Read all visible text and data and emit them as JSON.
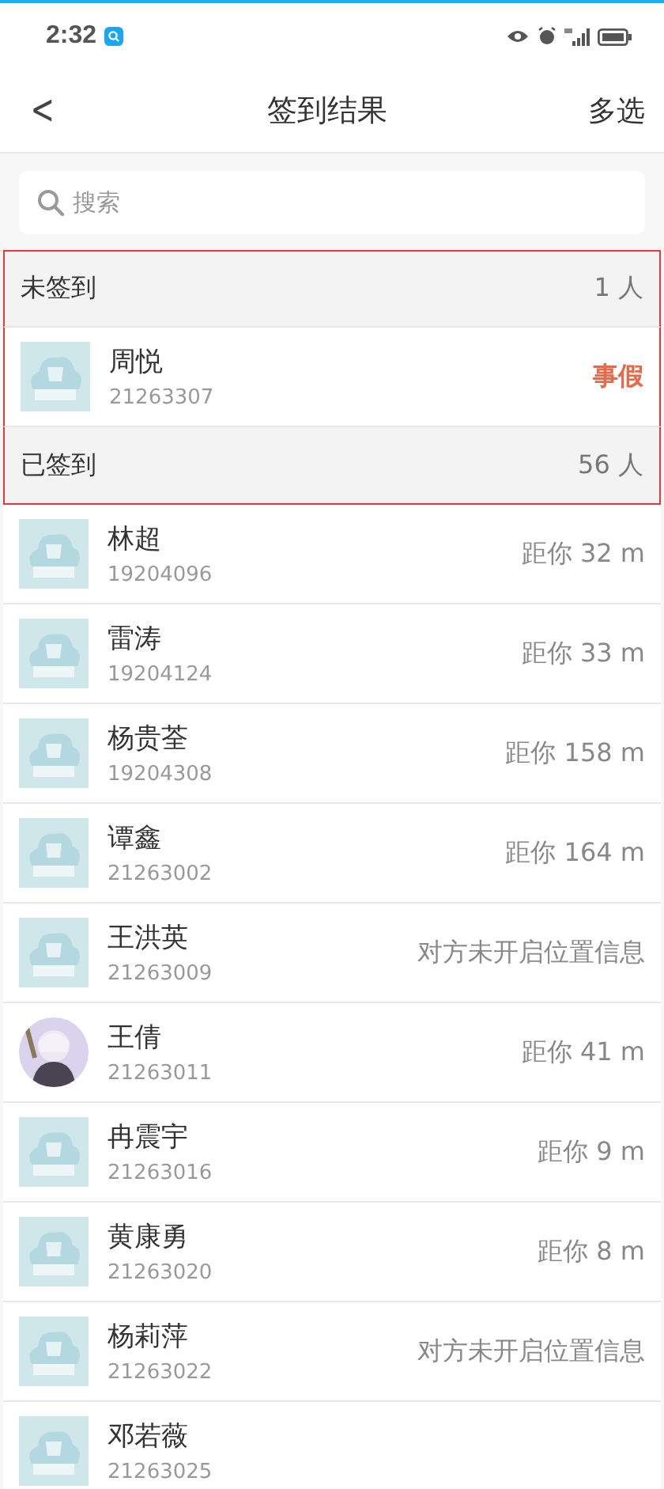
{
  "status_bar": {
    "time": "2:32"
  },
  "header": {
    "back": "<",
    "title": "签到结果",
    "action": "多选"
  },
  "search": {
    "placeholder": "搜索"
  },
  "items": [
    {
      "kind": "header",
      "title": "未签到",
      "count": "1 人",
      "highlighted": true
    },
    {
      "kind": "person",
      "name": "周悦",
      "id": "21263307",
      "status": {
        "text": "事假",
        "kind": "leave"
      },
      "avatar": {
        "kind": "placeholder"
      },
      "highlighted": true
    },
    {
      "kind": "header",
      "title": "已签到",
      "count": "56 人",
      "highlighted": true
    },
    {
      "kind": "person",
      "name": "林超",
      "id": "19204096",
      "status": {
        "text": "距你 32 m",
        "kind": "distance"
      },
      "avatar": {
        "kind": "placeholder"
      },
      "highlighted": false
    },
    {
      "kind": "person",
      "name": "雷涛",
      "id": "19204124",
      "status": {
        "text": "距你 33 m",
        "kind": "distance"
      },
      "avatar": {
        "kind": "placeholder"
      },
      "highlighted": false
    },
    {
      "kind": "person",
      "name": "杨贵荃",
      "id": "19204308",
      "status": {
        "text": "距你 158 m",
        "kind": "distance"
      },
      "avatar": {
        "kind": "placeholder"
      },
      "highlighted": false
    },
    {
      "kind": "person",
      "name": "谭鑫",
      "id": "21263002",
      "status": {
        "text": "距你 164 m",
        "kind": "distance"
      },
      "avatar": {
        "kind": "placeholder"
      },
      "highlighted": false
    },
    {
      "kind": "person",
      "name": "王洪英",
      "id": "21263009",
      "status": {
        "text": "对方未开启位置信息",
        "kind": "distance"
      },
      "avatar": {
        "kind": "placeholder"
      },
      "highlighted": false
    },
    {
      "kind": "person",
      "name": "王倩",
      "id": "21263011",
      "status": {
        "text": "距你 41 m",
        "kind": "distance"
      },
      "highlighted": false
    },
    {
      "kind": "person",
      "name": "冉震宇",
      "id": "21263016",
      "status": {
        "text": "距你 9 m",
        "kind": "distance"
      },
      "avatar": {
        "kind": "placeholder"
      },
      "highlighted": false
    },
    {
      "kind": "person",
      "name": "黄康勇",
      "id": "21263020",
      "status": {
        "text": "距你 8 m",
        "kind": "distance"
      },
      "avatar": {
        "kind": "placeholder"
      },
      "highlighted": false
    },
    {
      "kind": "person",
      "name": "杨莉萍",
      "id": "21263022",
      "status": {
        "text": "对方未开启位置信息",
        "kind": "distance"
      },
      "avatar": {
        "kind": "placeholder"
      },
      "highlighted": false
    },
    {
      "kind": "person",
      "name": "邓若薇",
      "id": "21263025",
      "avatar": {
        "kind": "placeholder"
      },
      "highlighted": false
    }
  ]
}
